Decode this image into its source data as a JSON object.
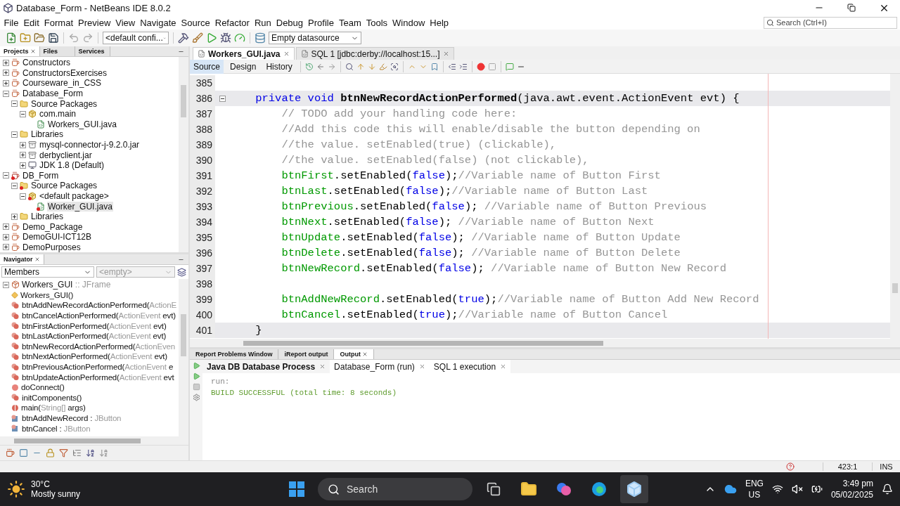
{
  "window": {
    "title": "Database_Form - NetBeans IDE 8.0.2"
  },
  "menu": [
    "File",
    "Edit",
    "Format",
    "Preview",
    "View",
    "Navigate",
    "Source",
    "Refactor",
    "Run",
    "Debug",
    "Profile",
    "Team",
    "Tools",
    "Window",
    "Help"
  ],
  "search": {
    "placeholder": "Search (Ctrl+I)"
  },
  "toolbar": {
    "config": "<default confi...",
    "datasource": "Empty datasource"
  },
  "projects_panel": {
    "tabs": [
      {
        "label": "Projects",
        "selected": true
      },
      {
        "label": "Files",
        "selected": false
      },
      {
        "label": "Services",
        "selected": false
      }
    ],
    "tree": [
      {
        "label": "Constructors",
        "kind": "project",
        "expanded": false
      },
      {
        "label": "ConstructorsExercises",
        "kind": "project",
        "expanded": false
      },
      {
        "label": "Courseware_in_CSS",
        "kind": "project",
        "expanded": false
      },
      {
        "label": "Database_Form",
        "kind": "project",
        "expanded": true,
        "children": [
          {
            "label": "Source Packages",
            "kind": "folder",
            "expanded": true,
            "children": [
              {
                "label": "com.main",
                "kind": "package",
                "expanded": true,
                "children": [
                  {
                    "label": "Workers_GUI.java",
                    "kind": "file"
                  }
                ]
              }
            ]
          },
          {
            "label": "Libraries",
            "kind": "folder",
            "expanded": true,
            "children": [
              {
                "label": "mysql-connector-j-9.2.0.jar",
                "kind": "jar",
                "expanded": false
              },
              {
                "label": "derbyclient.jar",
                "kind": "jar",
                "expanded": false
              },
              {
                "label": "JDK 1.8 (Default)",
                "kind": "jdk",
                "expanded": false
              }
            ]
          }
        ]
      },
      {
        "label": "DB_Form",
        "kind": "project",
        "expanded": true,
        "error": true,
        "children": [
          {
            "label": "Source Packages",
            "kind": "folder",
            "expanded": true,
            "error": true,
            "children": [
              {
                "label": "<default package>",
                "kind": "package",
                "expanded": true,
                "error": true,
                "children": [
                  {
                    "label": "Worker_GUI.java",
                    "kind": "file",
                    "error": true,
                    "selected": true
                  }
                ]
              }
            ]
          },
          {
            "label": "Libraries",
            "kind": "folder",
            "expanded": false
          }
        ]
      },
      {
        "label": "Demo_Package",
        "kind": "project",
        "expanded": false
      },
      {
        "label": "DemoGUI-ICT12B",
        "kind": "project",
        "expanded": false
      },
      {
        "label": "DemoPurposes",
        "kind": "project",
        "expanded": false
      }
    ]
  },
  "navigator": {
    "title": "Navigator",
    "filter": "Members",
    "scope_placeholder": "<empty>",
    "root": {
      "name": "Workers_GUI",
      "type": " :: JFrame",
      "expanded": true,
      "children": [
        {
          "kind": "constructor",
          "name": "Workers_GUI()"
        },
        {
          "kind": "method",
          "name": "btnAddNewRecordActionPerformed(",
          "type": "ActionE"
        },
        {
          "kind": "method",
          "name": "btnCancelActionPerformed(",
          "type": "ActionEvent",
          "suffix": " evt)"
        },
        {
          "kind": "method",
          "name": "btnFirstActionPerformed(",
          "type": "ActionEvent",
          "suffix": " evt)"
        },
        {
          "kind": "method",
          "name": "btnLastActionPerformed(",
          "type": "ActionEvent",
          "suffix": " evt)"
        },
        {
          "kind": "method",
          "name": "btnNewRecordActionPerformed(",
          "type": "ActionEven"
        },
        {
          "kind": "method",
          "name": "btnNextActionPerformed(",
          "type": "ActionEvent",
          "suffix": " evt)"
        },
        {
          "kind": "method",
          "name": "btnPreviousActionPerformed(",
          "type": "ActionEvent",
          "suffix": " e"
        },
        {
          "kind": "method",
          "name": "btnUpdateActionPerformed(",
          "type": "ActionEvent",
          "suffix": " evt"
        },
        {
          "kind": "private",
          "name": "doConnect()"
        },
        {
          "kind": "method",
          "name": "initComponents()"
        },
        {
          "kind": "static",
          "name": "main(",
          "type": "String[]",
          "suffix": " args)"
        },
        {
          "kind": "field",
          "name": "btnAddNewRecord : ",
          "type": "JButton"
        },
        {
          "kind": "field",
          "name": "btnCancel : ",
          "type": "JButton"
        }
      ]
    }
  },
  "editor": {
    "tabs": [
      {
        "label": "Workers_GUI.java",
        "selected": true
      },
      {
        "label": "SQL 1 [jdbc:derby://localhost:15...]",
        "selected": false
      }
    ],
    "views": [
      {
        "label": "Source",
        "selected": true
      },
      {
        "label": "Design",
        "selected": false
      },
      {
        "label": "History",
        "selected": false
      }
    ],
    "lines": [
      {
        "number": "385",
        "highlighted": false
      },
      {
        "number": "386",
        "highlighted": true,
        "segments": [
          {
            "kind": "keyword",
            "text": "    private void "
          },
          {
            "kind": "method",
            "text": "btnNewRecordActionPerformed"
          },
          {
            "kind": "plain",
            "text": "(java.awt.event.ActionEvent evt) {"
          }
        ]
      },
      {
        "number": "387",
        "highlighted": false,
        "segments": [
          {
            "kind": "comment",
            "text": "        // TODO add your handling code here:"
          }
        ]
      },
      {
        "number": "388",
        "highlighted": false,
        "segments": [
          {
            "kind": "comment",
            "text": "        //Add this code this will enable/disable the button depending on"
          }
        ]
      },
      {
        "number": "389",
        "highlighted": false,
        "segments": [
          {
            "kind": "comment",
            "text": "        //the value. setEnabled(true) (clickable),"
          }
        ]
      },
      {
        "number": "390",
        "highlighted": false,
        "segments": [
          {
            "kind": "comment",
            "text": "        //the value. setEnabled(false) (not clickable),"
          }
        ]
      },
      {
        "number": "391",
        "highlighted": false,
        "segments": [
          {
            "kind": "field",
            "text": "        btnFirst"
          },
          {
            "kind": "plain",
            "text": ".setEnabled("
          },
          {
            "kind": "keyword",
            "text": "false"
          },
          {
            "kind": "plain",
            "text": ");"
          },
          {
            "kind": "comment",
            "text": "//Variable name of Button First"
          }
        ]
      },
      {
        "number": "392",
        "highlighted": false,
        "segments": [
          {
            "kind": "field",
            "text": "        btnLast"
          },
          {
            "kind": "plain",
            "text": ".setEnabled("
          },
          {
            "kind": "keyword",
            "text": "false"
          },
          {
            "kind": "plain",
            "text": ");"
          },
          {
            "kind": "comment",
            "text": "//Variable name of Button Last"
          }
        ]
      },
      {
        "number": "393",
        "highlighted": false,
        "segments": [
          {
            "kind": "field",
            "text": "        btnPrevious"
          },
          {
            "kind": "plain",
            "text": ".setEnabled("
          },
          {
            "kind": "keyword",
            "text": "false"
          },
          {
            "kind": "plain",
            "text": "); "
          },
          {
            "kind": "comment",
            "text": "//Variable name of Button Previous"
          }
        ]
      },
      {
        "number": "394",
        "highlighted": false,
        "segments": [
          {
            "kind": "field",
            "text": "        btnNext"
          },
          {
            "kind": "plain",
            "text": ".setEnabled("
          },
          {
            "kind": "keyword",
            "text": "false"
          },
          {
            "kind": "plain",
            "text": "); "
          },
          {
            "kind": "comment",
            "text": "//Variable name of Button Next"
          }
        ]
      },
      {
        "number": "395",
        "highlighted": false,
        "segments": [
          {
            "kind": "field",
            "text": "        btnUpdate"
          },
          {
            "kind": "plain",
            "text": ".setEnabled("
          },
          {
            "kind": "keyword",
            "text": "false"
          },
          {
            "kind": "plain",
            "text": "); "
          },
          {
            "kind": "comment",
            "text": "//Variable name of Button Update"
          }
        ]
      },
      {
        "number": "396",
        "highlighted": false,
        "segments": [
          {
            "kind": "field",
            "text": "        btnDelete"
          },
          {
            "kind": "plain",
            "text": ".setEnabled("
          },
          {
            "kind": "keyword",
            "text": "false"
          },
          {
            "kind": "plain",
            "text": "); "
          },
          {
            "kind": "comment",
            "text": "//Variable name of Button Delete"
          }
        ]
      },
      {
        "number": "397",
        "highlighted": false,
        "segments": [
          {
            "kind": "field",
            "text": "        btnNewRecord"
          },
          {
            "kind": "plain",
            "text": ".setEnabled("
          },
          {
            "kind": "keyword",
            "text": "false"
          },
          {
            "kind": "plain",
            "text": "); "
          },
          {
            "kind": "comment",
            "text": "//Variable name of Button New Record"
          }
        ]
      },
      {
        "number": "398",
        "highlighted": false
      },
      {
        "number": "399",
        "highlighted": false,
        "segments": [
          {
            "kind": "field",
            "text": "        btnAddNewRecord"
          },
          {
            "kind": "plain",
            "text": ".setEnabled("
          },
          {
            "kind": "keyword",
            "text": "true"
          },
          {
            "kind": "plain",
            "text": ");"
          },
          {
            "kind": "comment",
            "text": "//Variable name of Button Add New Record"
          }
        ]
      },
      {
        "number": "400",
        "highlighted": false,
        "segments": [
          {
            "kind": "field",
            "text": "        btnCancel"
          },
          {
            "kind": "plain",
            "text": ".setEnabled("
          },
          {
            "kind": "keyword",
            "text": "true"
          },
          {
            "kind": "plain",
            "text": ");"
          },
          {
            "kind": "comment",
            "text": "//Variable name of Button Cancel"
          }
        ]
      },
      {
        "number": "401",
        "highlighted": true,
        "segments": [
          {
            "kind": "plain",
            "text": "    }"
          }
        ]
      }
    ]
  },
  "output": {
    "tabs": [
      {
        "label": "Report Problems Window",
        "selected": false
      },
      {
        "label": "iReport output",
        "selected": false
      },
      {
        "label": "Output",
        "selected": true
      }
    ],
    "subtabs": [
      {
        "label": "Java DB Database Process",
        "selected": true
      },
      {
        "label": "Database_Form (run)",
        "selected": false
      },
      {
        "label": "SQL 1 execution",
        "selected": false
      }
    ],
    "lines": [
      "run:",
      "BUILD SUCCESSFUL (total time: 8 seconds)"
    ]
  },
  "status_bar": {
    "position": "423:1",
    "mode": "INS"
  },
  "taskbar": {
    "temperature": "30°C",
    "condition": "Mostly sunny",
    "search": "Search",
    "language": "ENG",
    "region": "US",
    "time": "3:49 pm",
    "date": "05/02/2025"
  }
}
